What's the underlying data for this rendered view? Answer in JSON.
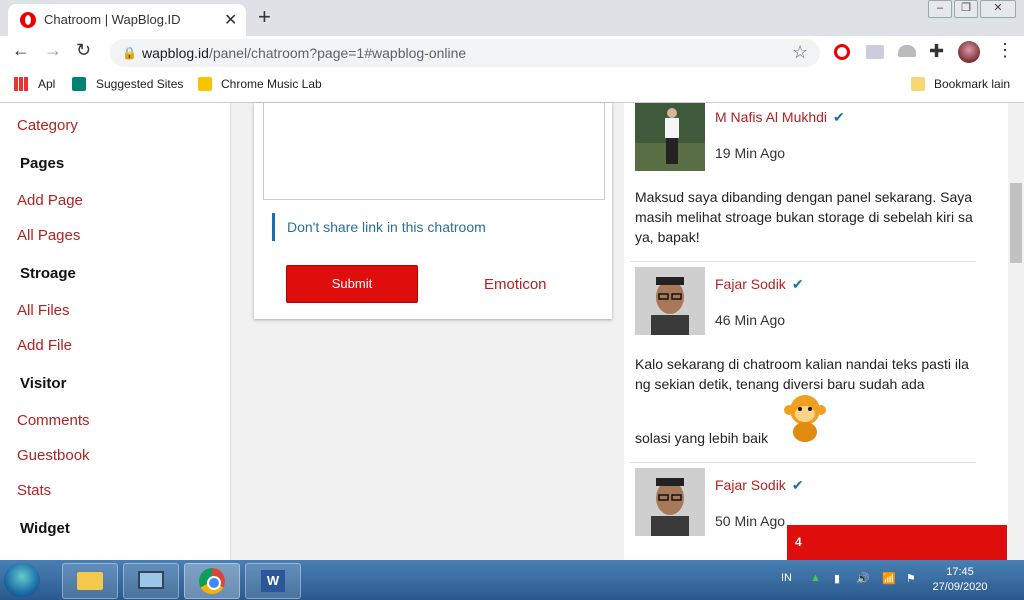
{
  "browser": {
    "tab_title": "Chatroom | WapBlog.ID",
    "tab_close": "✕",
    "new_tab": "+",
    "url_host": "wapblog.id",
    "url_path": "/panel/chatroom?page=1#wapblog-online",
    "bookmarks": [
      "Apl",
      "Suggested Sites",
      "Chrome Music Lab",
      "Bookmark lain"
    ]
  },
  "sidebar": {
    "items": [
      {
        "type": "link",
        "label": "Category"
      },
      {
        "type": "head",
        "label": "Pages"
      },
      {
        "type": "link",
        "label": "Add Page"
      },
      {
        "type": "link",
        "label": "All Pages"
      },
      {
        "type": "head",
        "label": "Stroage"
      },
      {
        "type": "link",
        "label": "All Files"
      },
      {
        "type": "link",
        "label": "Add File"
      },
      {
        "type": "head",
        "label": "Visitor"
      },
      {
        "type": "link",
        "label": "Comments"
      },
      {
        "type": "link",
        "label": "Guestbook"
      },
      {
        "type": "link",
        "label": "Stats"
      },
      {
        "type": "head",
        "label": "Widget"
      }
    ]
  },
  "form": {
    "notice": "Don't share link in this chatroom",
    "submit_label": "Submit",
    "emoticon_label": "Emoticon"
  },
  "chat": {
    "entries": [
      {
        "name": "M Nafis Al Mukhdi",
        "time": "19 Min Ago",
        "message": "Maksud saya dibanding dengan panel sekarang. Saya masih melihat stroage bukan storage di sebelah kiri saya, bapak!"
      },
      {
        "name": "Fajar Sodik",
        "time": "46 Min Ago",
        "message": "Kalo sekarang di chatroom kalian nandai teks pasti ilang sekian detik, tenang diversi baru sudah ada",
        "message2": "solasi yang lebih baik"
      },
      {
        "name": "Fajar Sodik",
        "time": "50 Min Ago"
      }
    ]
  },
  "notification": {
    "count": "4"
  },
  "taskbar": {
    "lang": "IN",
    "time": "17:45",
    "date": "27/09/2020"
  },
  "colors": {
    "accent": "#e00d0d",
    "link": "#b22222",
    "notice": "#2a6f9a"
  }
}
